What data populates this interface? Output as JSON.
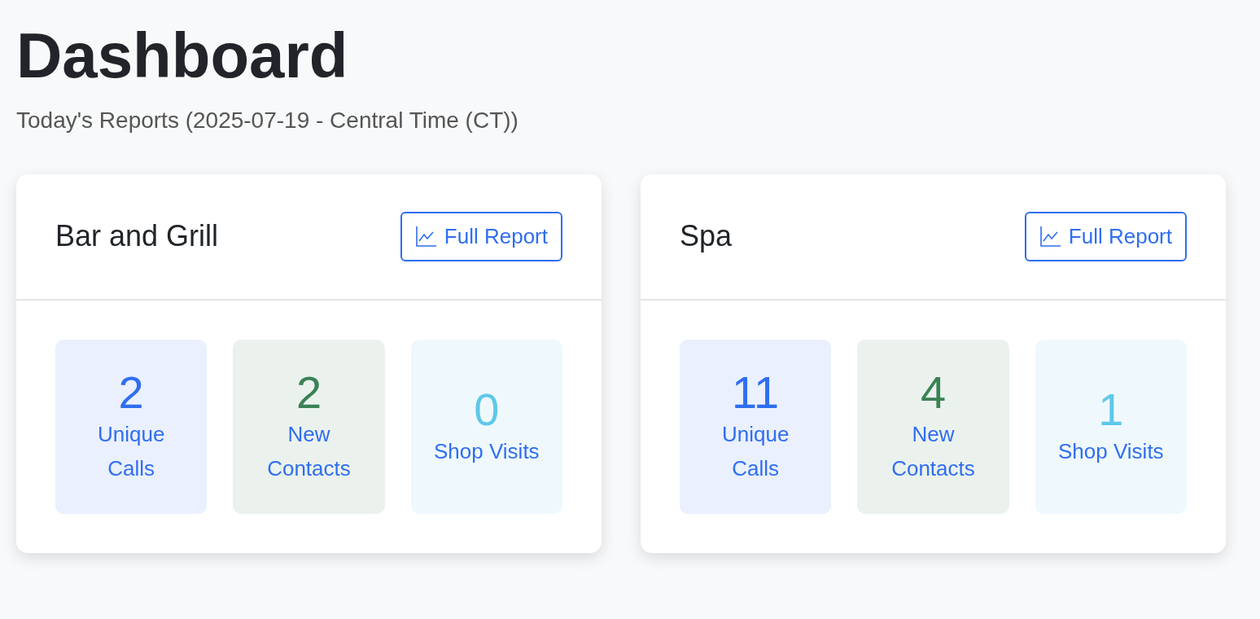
{
  "page": {
    "title": "Dashboard",
    "subtitle": "Today's Reports (2025-07-19 - Central Time (CT))"
  },
  "cards": [
    {
      "name": "Bar and Grill",
      "button": "Full Report",
      "stats": [
        {
          "value": "2",
          "label": "Unique Calls",
          "color": "#2f6ef0"
        },
        {
          "value": "2",
          "label": "New Contacts",
          "color": "#3a8255"
        },
        {
          "value": "0",
          "label": "Shop Visits",
          "color": "#5ec8ea"
        }
      ]
    },
    {
      "name": "Spa",
      "button": "Full Report",
      "stats": [
        {
          "value": "11",
          "label": "Unique Calls",
          "color": "#2f6ef0"
        },
        {
          "value": "4",
          "label": "New Contacts",
          "color": "#3a8255"
        },
        {
          "value": "1",
          "label": "Shop Visits",
          "color": "#5ec8ea"
        }
      ]
    }
  ]
}
